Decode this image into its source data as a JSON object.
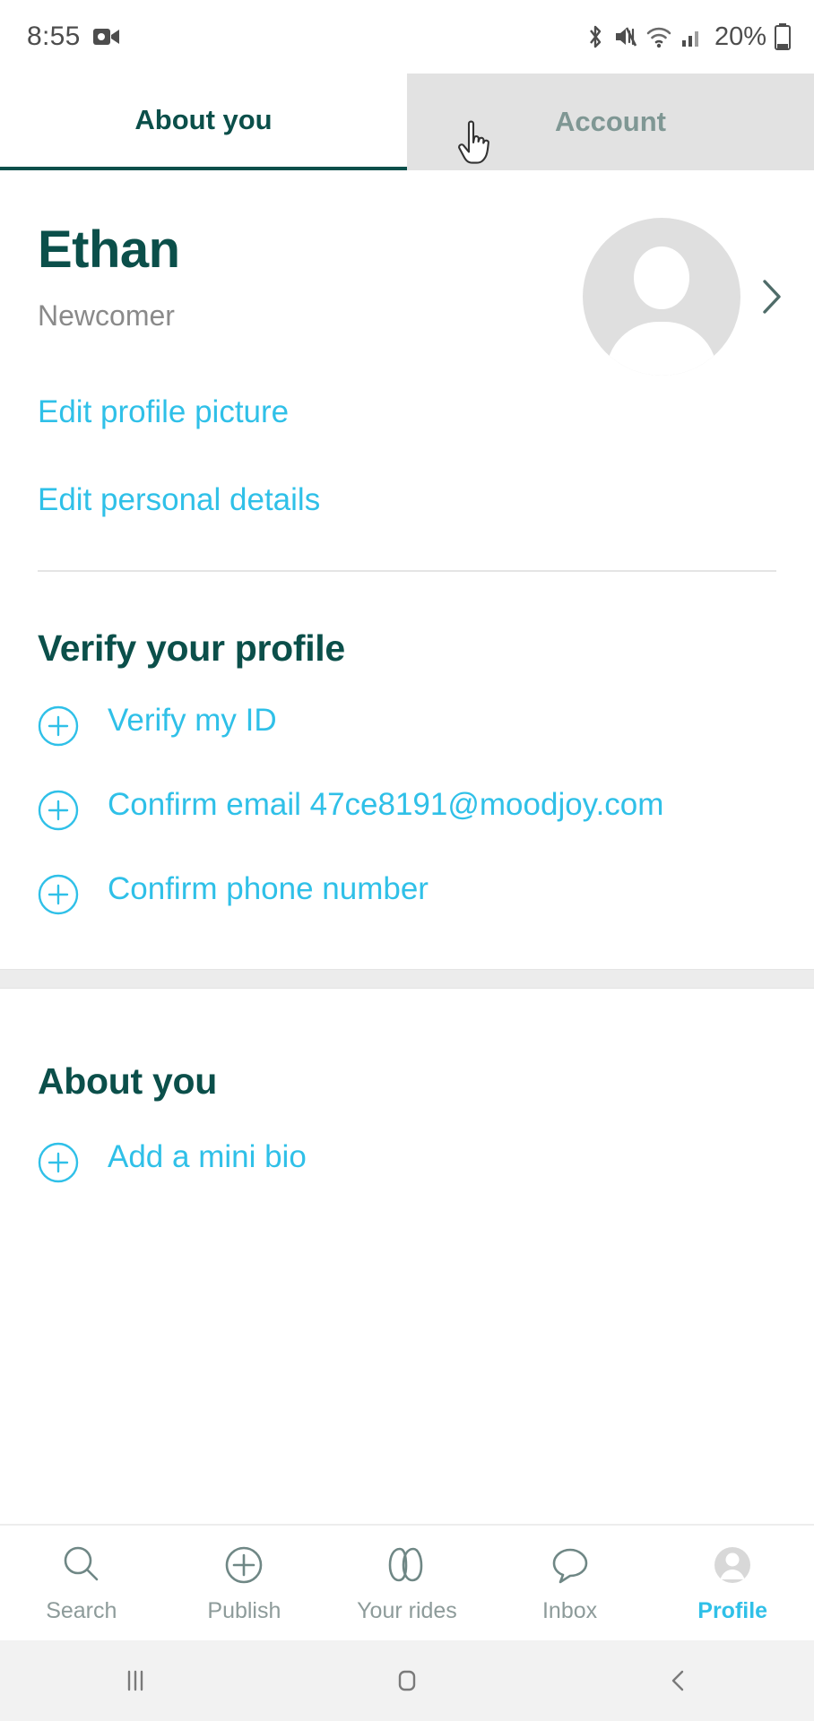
{
  "status_bar": {
    "time": "8:55",
    "battery_percent": "20%",
    "icons": [
      "video-camera-icon",
      "bluetooth-icon",
      "mute-icon",
      "wifi-icon",
      "cellular-signal-icon",
      "battery-icon"
    ]
  },
  "tabs": [
    {
      "label": "About you",
      "active": true
    },
    {
      "label": "Account",
      "active": false
    }
  ],
  "profile": {
    "name": "Ethan",
    "level": "Newcomer",
    "avatar_placeholder": "person-avatar-icon",
    "chevron": "chevron-right-icon",
    "edit_picture_label": "Edit profile picture",
    "edit_details_label": "Edit personal details"
  },
  "verify_section": {
    "title": "Verify your profile",
    "items": [
      {
        "label": "Verify my ID"
      },
      {
        "label": "Confirm email 47ce8191@moodjoy.com"
      },
      {
        "label": "Confirm phone number"
      }
    ]
  },
  "about_section": {
    "title": "About you",
    "items": [
      {
        "label": "Add a mini bio"
      }
    ]
  },
  "bottom_nav": [
    {
      "label": "Search",
      "icon": "search-icon",
      "active": false
    },
    {
      "label": "Publish",
      "icon": "plus-circle-icon",
      "active": false
    },
    {
      "label": "Your rides",
      "icon": "rides-icon",
      "active": false
    },
    {
      "label": "Inbox",
      "icon": "chat-bubble-icon",
      "active": false
    },
    {
      "label": "Profile",
      "icon": "person-icon",
      "active": true
    }
  ],
  "system_nav": [
    "recents-button",
    "home-button",
    "back-button"
  ],
  "colors": {
    "brand_dark": "#0b4f4a",
    "link_cyan": "#2fc0e8",
    "muted_gray": "#8a8a8a",
    "tab_inactive_bg": "#e2e2e2"
  }
}
